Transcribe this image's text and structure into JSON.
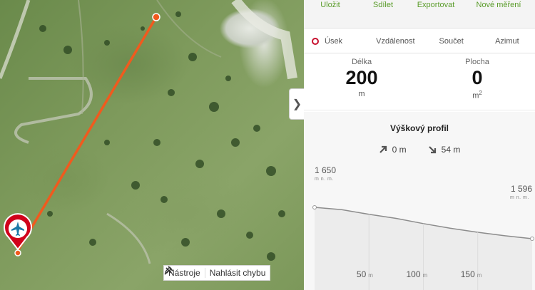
{
  "toolbar": {
    "save": "Uložit",
    "share": "Sdílet",
    "export": "Exportovat",
    "new_measure": "Nové měření"
  },
  "modes": {
    "segment": "Úsek",
    "distance": "Vzdálenost",
    "sum": "Součet",
    "azimuth": "Azimut",
    "selected": "segment"
  },
  "stats": {
    "length_label": "Délka",
    "length_value": "200",
    "length_unit": "m",
    "area_label": "Plocha",
    "area_value": "0",
    "area_unit": "m",
    "area_unit_sup": "2"
  },
  "profile": {
    "title": "Výškový profil",
    "ascent": "0 m",
    "descent": "54 m",
    "start_elev": "1 650",
    "end_elev": "1 596",
    "elev_unit": "m n. m."
  },
  "chart_data": {
    "type": "area",
    "x": [
      0,
      25,
      50,
      75,
      100,
      125,
      150,
      175,
      200
    ],
    "y": [
      1650,
      1646,
      1638,
      1631,
      1622,
      1614,
      1607,
      1601,
      1596
    ],
    "xlim": [
      0,
      200
    ],
    "ylim": [
      1596,
      1650
    ],
    "x_ticks": [
      50,
      100,
      150
    ],
    "x_unit": "m",
    "line_color": "#8c8c8c",
    "fill_color": "#ececec"
  },
  "map": {
    "tools_label": "Nástroje",
    "report_label": "Nahlásit chybu",
    "line_color": "#f05a1e",
    "marker_color": "#d0021b",
    "marker_icon": "airplane-icon"
  },
  "colors": {
    "accent_green": "#5a9c2a",
    "accent_red": "#c8102e"
  }
}
